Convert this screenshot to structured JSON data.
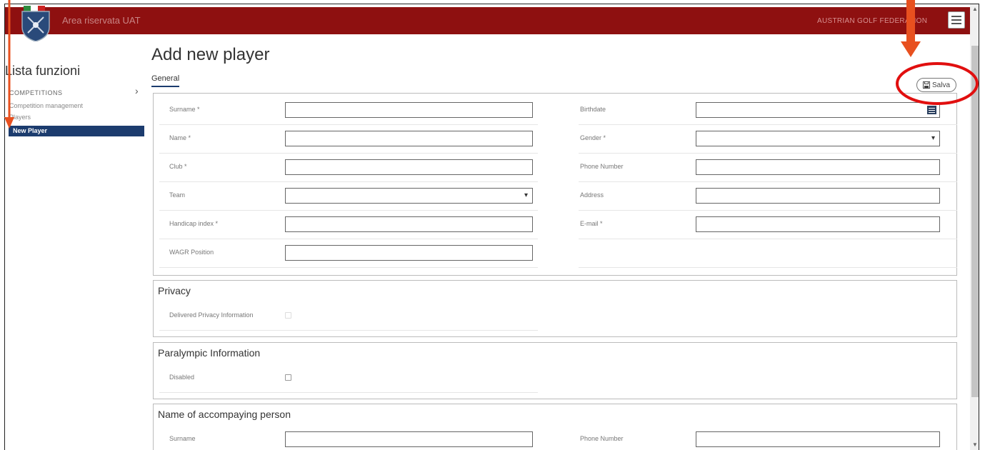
{
  "header": {
    "app_title": "Area riservata UAT",
    "org_name": "AUSTRIAN GOLF FEDERATION",
    "menu_icon": "hamburger-menu-icon",
    "bar_color": "#8e1010"
  },
  "sidebar": {
    "title": "Lista funzioni",
    "section": "COMPETITIONS",
    "items": [
      {
        "label": "Competition management",
        "active": false
      },
      {
        "label": "Players",
        "active": false
      },
      {
        "label": "New Player",
        "active": true
      }
    ],
    "active_color": "#1c3c6e"
  },
  "main": {
    "title": "Add new player",
    "tabs": [
      {
        "label": "General",
        "active": true
      }
    ],
    "save_label": "Salva",
    "save_icon": "floppy-disk-icon",
    "general": {
      "left_fields": [
        {
          "label": "Surname *",
          "type": "text",
          "value": ""
        },
        {
          "label": "Name *",
          "type": "text",
          "value": ""
        },
        {
          "label": "Club *",
          "type": "text",
          "value": ""
        },
        {
          "label": "Team",
          "type": "select",
          "value": ""
        },
        {
          "label": "Handicap index *",
          "type": "text",
          "value": ""
        },
        {
          "label": "WAGR Position",
          "type": "text",
          "value": ""
        }
      ],
      "right_fields": [
        {
          "label": "Birthdate",
          "type": "date",
          "value": ""
        },
        {
          "label": "Gender *",
          "type": "select",
          "value": ""
        },
        {
          "label": "Phone Number",
          "type": "text",
          "value": ""
        },
        {
          "label": "Address",
          "type": "text",
          "value": ""
        },
        {
          "label": "E-mail *",
          "type": "text",
          "value": ""
        }
      ]
    },
    "privacy": {
      "title": "Privacy",
      "field_label": "Delivered Privacy Information",
      "checked": false
    },
    "paralympic": {
      "title": "Paralympic Information",
      "field_label": "Disabled",
      "checked": false
    },
    "accompanying": {
      "title": "Name of accompaying person",
      "left_label": "Surname",
      "right_label": "Phone Number"
    }
  },
  "annotations": {
    "color": "#e8501f",
    "circle_color": "#e10f0f"
  }
}
